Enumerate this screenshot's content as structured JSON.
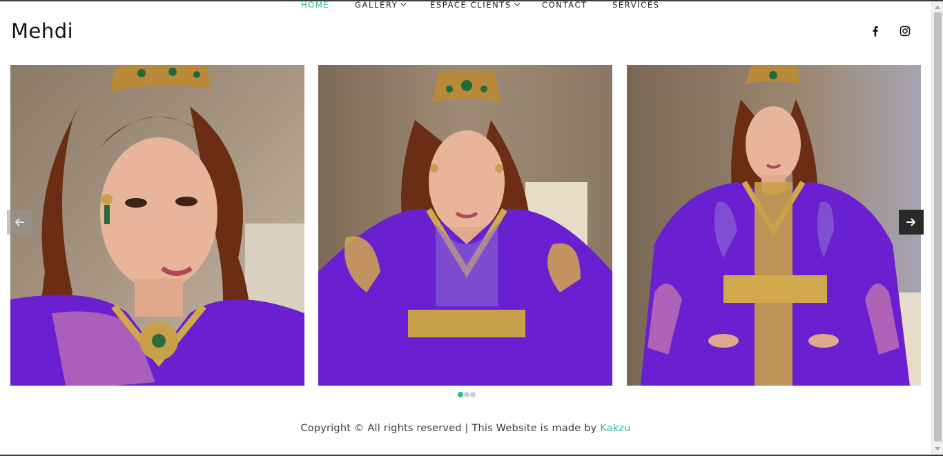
{
  "site": {
    "logo": "Mehdi"
  },
  "nav": {
    "items": [
      {
        "label": "HOME",
        "active": true
      },
      {
        "label": "GALLERY",
        "has_dropdown": true
      },
      {
        "label": "ESPACE CLIENTS",
        "has_dropdown": true
      },
      {
        "label": "CONTACT"
      },
      {
        "label": "SERVICES"
      }
    ]
  },
  "social": {
    "icons": [
      "facebook-icon",
      "instagram-icon"
    ]
  },
  "carousel": {
    "slides_visible": 3,
    "active_dot": 0,
    "dot_count": 3,
    "prev_icon": "arrow-left-icon",
    "next_icon": "arrow-right-icon"
  },
  "footer": {
    "text": "Copyright © All rights reserved | This Website is made by ",
    "link_label": "Kakzu"
  },
  "colors": {
    "accent": "#2eb89a",
    "text": "#1d1d1d",
    "dress": "#6a1fd0",
    "gold": "#c9a04a"
  }
}
